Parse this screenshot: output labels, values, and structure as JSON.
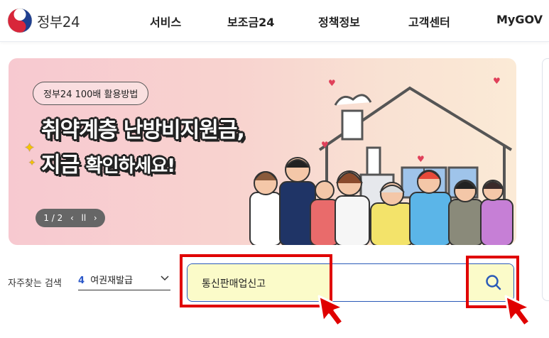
{
  "header": {
    "logo_text": "정부24",
    "nav": [
      "서비스",
      "보조금24",
      "정책정보",
      "고객센터",
      "MyGOV"
    ]
  },
  "banner": {
    "tag": "정부24 100배 활용방법",
    "headline_line1": "취약계층 난방비지원금,",
    "headline_line2_a": "지금",
    "headline_line2_b": "확인하세요!",
    "pager": {
      "current": "1",
      "total": "2",
      "label": "1 / 2"
    }
  },
  "search": {
    "frequent_label": "자주찾는 검색",
    "frequent_number": "4",
    "frequent_value": "여권재발급",
    "query": "통신판매업신고"
  },
  "colors": {
    "brand_blue": "#2a5ab8",
    "highlight_red": "#e00000",
    "search_fill": "#fbfbc9"
  },
  "icons": [
    "taegeuk-logo-icon",
    "chevron-down-icon",
    "search-icon",
    "cursor-arrow-icon"
  ]
}
